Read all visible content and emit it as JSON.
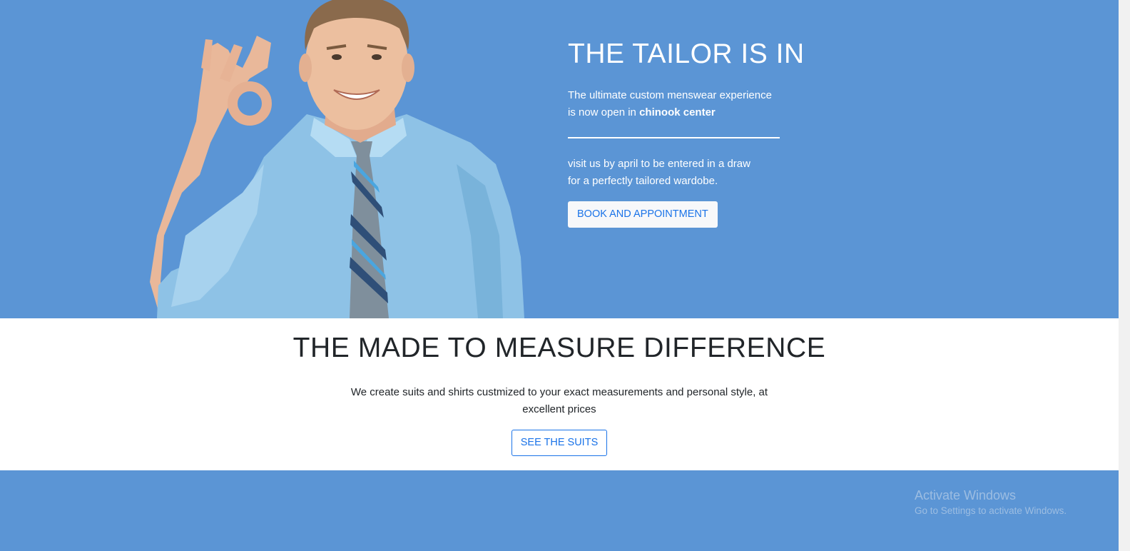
{
  "hero": {
    "title": "THE TAILOR IS IN",
    "line1": "The ultimate custom menswear experience",
    "line2_prefix": "is now open in ",
    "line2_bold": "chinook center",
    "draw_line1": "visit us by april to be entered in a draw",
    "draw_line2": "for a perfectly tailored wardobe.",
    "button_label": "BOOK AND APPOINTMENT"
  },
  "difference": {
    "title": "THE MADE TO MEASURE DIFFERENCE",
    "text": "We create suits and shirts custmized to your exact measurements and personal style, at excellent prices",
    "button_label": "SEE THE SUITS"
  },
  "watermark": {
    "title": "Activate Windows",
    "subtitle": "Go to Settings to activate Windows."
  },
  "colors": {
    "brand_blue": "#5b95d5",
    "link_blue": "#1a73e8",
    "text_dark": "#212529"
  }
}
